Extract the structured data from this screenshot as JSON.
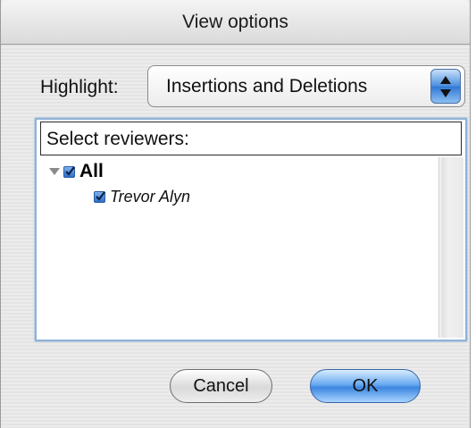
{
  "window": {
    "title": "View options"
  },
  "highlight": {
    "label": "Highlight:",
    "selected_value": "Insertions and Deletions"
  },
  "reviewers": {
    "header": "Select reviewers:",
    "items": [
      {
        "label": "All",
        "checked": true,
        "expanded": true
      },
      {
        "label": "Trevor Alyn",
        "checked": true
      }
    ]
  },
  "buttons": {
    "cancel_label": "Cancel",
    "ok_label": "OK"
  },
  "colors": {
    "accent": "#3d86e0",
    "selection_border": "#8fb1d6"
  }
}
